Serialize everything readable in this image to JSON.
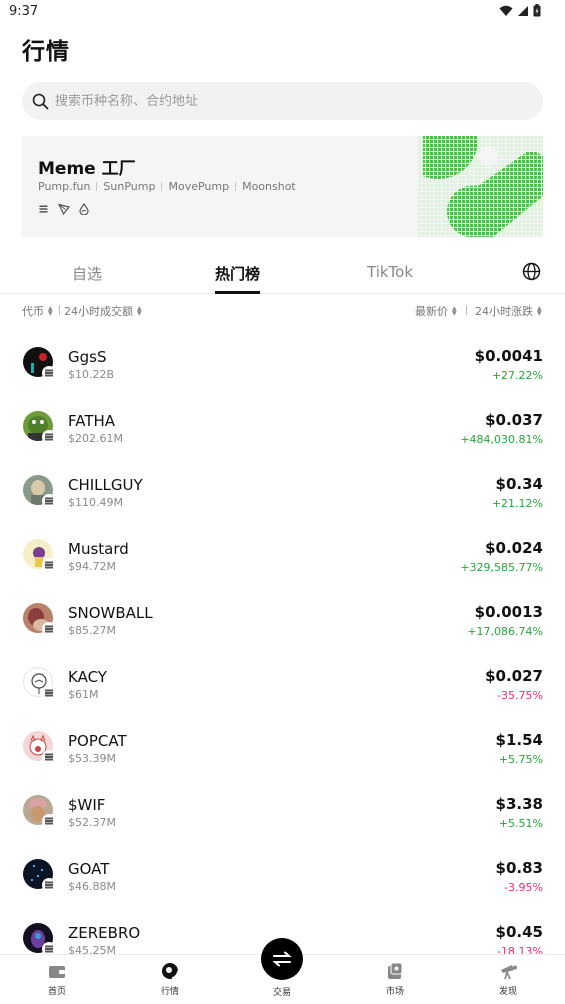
{
  "status_bar": {
    "time": "9:37"
  },
  "page_title": "行情",
  "search": {
    "placeholder": "搜索币种名称、合约地址"
  },
  "banner": {
    "title": "Meme 工厂",
    "links": [
      "Pump.fun",
      "SunPump",
      "MovePump",
      "Moonshot"
    ],
    "chain_icons": [
      "solana-icon",
      "tron-icon",
      "sui-drop-icon"
    ]
  },
  "tabs": [
    {
      "label": "自选",
      "active": false
    },
    {
      "label": "热门榜",
      "active": true
    },
    {
      "label": "TikTok",
      "active": false
    }
  ],
  "sort_bar": {
    "left": [
      "代币",
      "24小时成交额"
    ],
    "right": [
      "最新价",
      "24小时涨跌"
    ]
  },
  "tokens": [
    {
      "symbol": "GgsS",
      "mcap": "$10.22B",
      "price": "$0.0041",
      "change": "+27.22%",
      "trend": "up"
    },
    {
      "symbol": "FATHA",
      "mcap": "$202.61M",
      "price": "$0.037",
      "change": "+484,030.81%",
      "trend": "up"
    },
    {
      "symbol": "CHILLGUY",
      "mcap": "$110.49M",
      "price": "$0.34",
      "change": "+21.12%",
      "trend": "up"
    },
    {
      "symbol": "Mustard",
      "mcap": "$94.72M",
      "price": "$0.024",
      "change": "+329,585.77%",
      "trend": "up"
    },
    {
      "symbol": "SNOWBALL",
      "mcap": "$85.27M",
      "price": "$0.0013",
      "change": "+17,086.74%",
      "trend": "up"
    },
    {
      "symbol": "KACY",
      "mcap": "$61M",
      "price": "$0.027",
      "change": "-35.75%",
      "trend": "down"
    },
    {
      "symbol": "POPCAT",
      "mcap": "$53.39M",
      "price": "$1.54",
      "change": "+5.75%",
      "trend": "up"
    },
    {
      "symbol": "$WIF",
      "mcap": "$52.37M",
      "price": "$3.38",
      "change": "+5.51%",
      "trend": "up"
    },
    {
      "symbol": "GOAT",
      "mcap": "$46.88M",
      "price": "$0.83",
      "change": "-3.95%",
      "trend": "down"
    },
    {
      "symbol": "ZEREBRO",
      "mcap": "$45.25M",
      "price": "$0.45",
      "change": "-18.13%",
      "trend": "down"
    }
  ],
  "bottom_nav": [
    {
      "label": "首页",
      "icon": "wallet-icon"
    },
    {
      "label": "行情",
      "icon": "market-icon"
    },
    {
      "label": "交易",
      "icon": "swap-icon"
    },
    {
      "label": "市场",
      "icon": "collection-icon"
    },
    {
      "label": "发现",
      "icon": "discover-icon"
    }
  ],
  "colors": {
    "up": "#27a63a",
    "down": "#ee2b76",
    "accent_green": "#3cc73c"
  }
}
